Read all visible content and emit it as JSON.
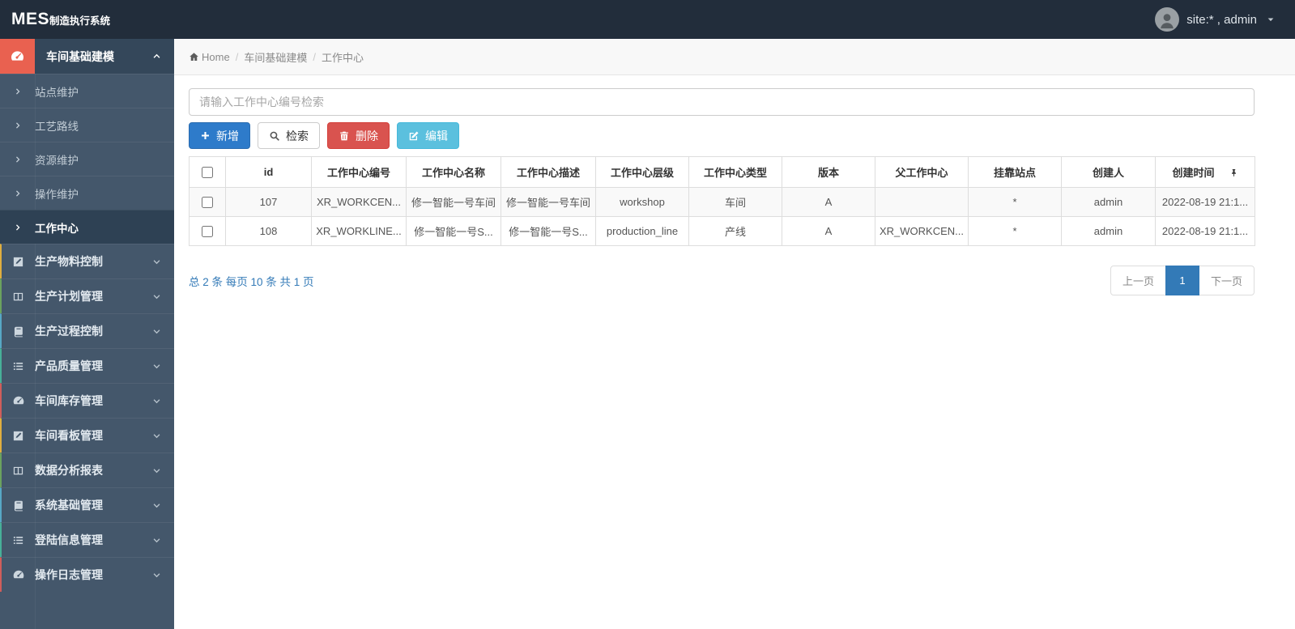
{
  "topbar": {
    "brand_primary": "MES",
    "brand_secondary": "制造执行系统",
    "user_label": "site:* , admin"
  },
  "breadcrumb": {
    "home": "Home",
    "section": "车间基础建模",
    "current": "工作中心"
  },
  "sidebar": {
    "active_group": {
      "label": "车间基础建模",
      "accent": "#e96150"
    },
    "submenu": [
      {
        "label": "站点维护"
      },
      {
        "label": "工艺路线"
      },
      {
        "label": "资源维护"
      },
      {
        "label": "操作维护"
      },
      {
        "label": "工作中心"
      }
    ],
    "groups": [
      {
        "label": "生产物料控制",
        "strip": "#dfae3f"
      },
      {
        "label": "生产计划管理",
        "strip": "#6ba25f"
      },
      {
        "label": "生产过程控制",
        "strip": "#57a7c5"
      },
      {
        "label": "产品质量管理",
        "strip": "#47b099"
      },
      {
        "label": "车间库存管理",
        "strip": "#d05e5b"
      },
      {
        "label": "车间看板管理",
        "strip": "#dfae3f"
      },
      {
        "label": "数据分析报表",
        "strip": "#6ba25f"
      },
      {
        "label": "系统基础管理",
        "strip": "#57a7c5"
      },
      {
        "label": "登陆信息管理",
        "strip": "#47b099"
      },
      {
        "label": "操作日志管理",
        "strip": "#d05e5b"
      }
    ]
  },
  "toolbar": {
    "search_placeholder": "请输入工作中心编号检索",
    "add_label": "新增",
    "search_label": "检索",
    "delete_label": "删除",
    "edit_label": "编辑"
  },
  "table": {
    "headers": [
      "id",
      "工作中心编号",
      "工作中心名称",
      "工作中心描述",
      "工作中心层级",
      "工作中心类型",
      "版本",
      "父工作中心",
      "挂靠站点",
      "创建人",
      "创建时间"
    ],
    "rows": [
      [
        "107",
        "XR_WORKCEN...",
        "修一智能一号车间",
        "修一智能一号车间",
        "workshop",
        "车间",
        "A",
        "",
        "*",
        "admin",
        "2022-08-19 21:1..."
      ],
      [
        "108",
        "XR_WORKLINE...",
        "修一智能一号S...",
        "修一智能一号S...",
        "production_line",
        "产线",
        "A",
        "XR_WORKCEN...",
        "*",
        "admin",
        "2022-08-19 21:1..."
      ]
    ]
  },
  "pagination": {
    "summary": "总 2 条 每页 10 条 共 1 页",
    "prev_label": "上一页",
    "page_label": "1",
    "next_label": "下一页"
  },
  "colors": {
    "topbar_bg": "#222d3b",
    "sidebar_bg": "#44576b",
    "active_accent": "#e96150",
    "primary_blue": "#2e7bca",
    "danger_red": "#d9534f",
    "info_cyan": "#5bc0de",
    "pagination_blue": "#337ab7"
  }
}
